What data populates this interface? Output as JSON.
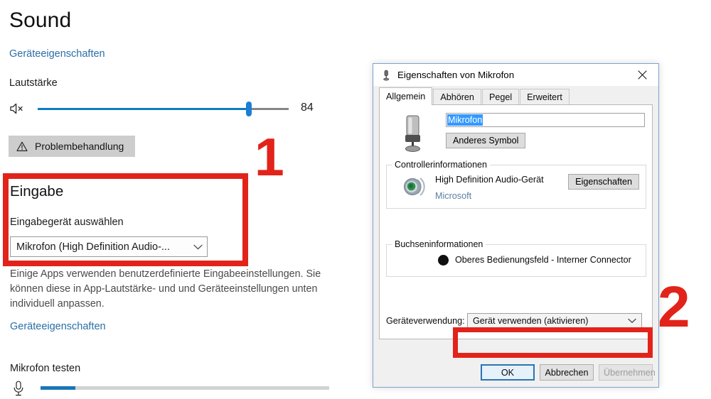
{
  "settings": {
    "page_title": "Sound",
    "device_properties_link_top": "Geräteeigenschaften",
    "volume": {
      "label": "Lautstärke",
      "value": "84",
      "percent": 84,
      "mute_icon": "speaker-mute-icon",
      "fill_color": "#0c7cc4",
      "thumb_color": "#1a7fd4"
    },
    "troubleshoot_button": {
      "label": "Problembehandlung",
      "icon": "warning-triangle-icon"
    },
    "input": {
      "section_title": "Eingabe",
      "select_label": "Eingabegerät auswählen",
      "selected_device": "Mikrofon (High Definition Audio-...",
      "chevron_icon": "chevron-down-icon",
      "help_text": "Einige Apps verwenden benutzerdefinierte Eingabeeinstellungen. Sie können diese in App-Lautstärke- und und Geräteeinstellungen unten individuell anpassen.",
      "device_properties_link": "Geräteeigenschaften"
    },
    "mic_test": {
      "label": "Mikrofon testen",
      "icon": "microphone-icon",
      "level_percent": 12,
      "fill_color": "#1a75b8"
    }
  },
  "annotations": {
    "color": "#e2231a",
    "number_one": "1",
    "number_two": "2"
  },
  "dialog": {
    "title": "Eigenschaften von Mikrofon",
    "title_icon": "microphone-icon",
    "close_icon": "close-icon",
    "tabs": [
      {
        "label": "Allgemein",
        "active": true
      },
      {
        "label": "Abhören",
        "active": false
      },
      {
        "label": "Pegel",
        "active": false
      },
      {
        "label": "Erweitert",
        "active": false
      }
    ],
    "general": {
      "device_icon": "microphone-device-icon",
      "device_name_value": "Mikrofon",
      "change_icon_button": "Anderes Symbol",
      "controller": {
        "legend": "Controllerinformationen",
        "icon": "audio-speaker-icon",
        "device_name": "High Definition Audio-Gerät",
        "vendor": "Microsoft",
        "properties_button": "Eigenschaften"
      },
      "jack": {
        "legend": "Buchseninformationen",
        "color_dot": "#101010",
        "description": "Oberes Bedienungsfeld - Interner Connector"
      },
      "device_usage": {
        "label": "Geräteverwendung:",
        "selected": "Gerät verwenden (aktivieren)",
        "chevron_icon": "chevron-down-icon"
      }
    },
    "buttons": {
      "ok": "OK",
      "cancel": "Abbrechen",
      "apply": "Übernehmen"
    }
  }
}
